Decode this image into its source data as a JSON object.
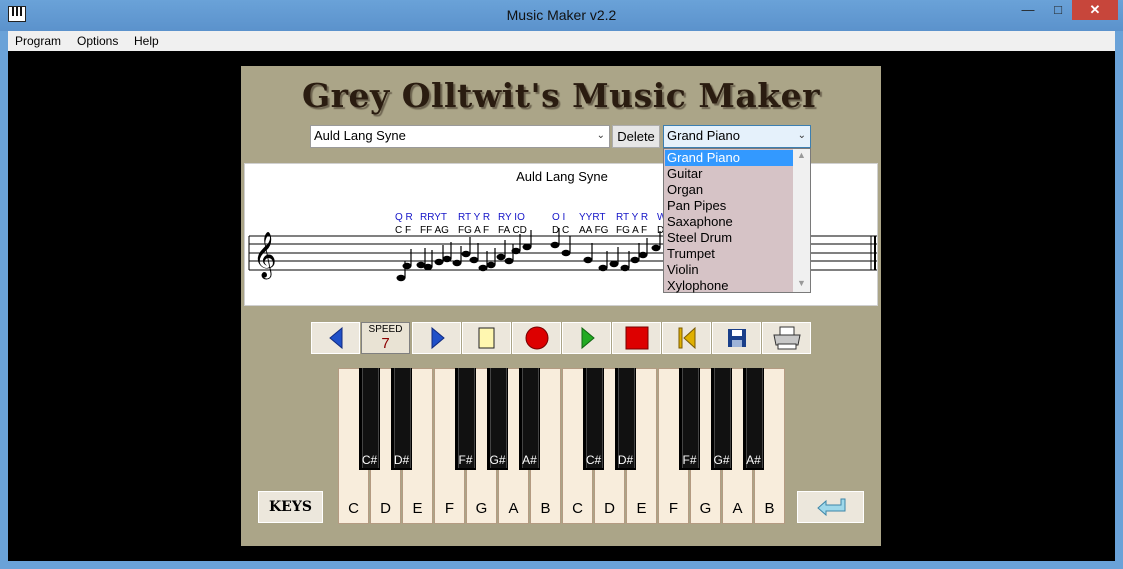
{
  "window": {
    "title": "Music Maker v2.2"
  },
  "menu": {
    "items": [
      "Program",
      "Options",
      "Help"
    ]
  },
  "app": {
    "heading": "Grey Olltwit's Music Maker"
  },
  "song_select": {
    "value": "Auld Lang Syne"
  },
  "delete_label": "Delete",
  "instrument_select": {
    "value": "Grand Piano",
    "options": [
      "Grand Piano",
      "Guitar",
      "Organ",
      "Pan Pipes",
      "Saxaphone",
      "Steel Drum",
      "Trumpet",
      "Violin",
      "Xylophone"
    ],
    "selected_index": 0
  },
  "score": {
    "title": "Auld Lang Syne",
    "key_letters": [
      "Q R",
      "RRYT",
      "RT Y R",
      "RY IO",
      "O I",
      "YYRT",
      "RT Y R",
      "W"
    ],
    "note_letters": [
      "C F",
      "FF AG",
      "FG A F",
      "FA CD",
      "D C",
      "AA FG",
      "FG A F",
      "D"
    ]
  },
  "speed": {
    "label": "SPEED",
    "value": "7"
  },
  "toolbar": {
    "icons": [
      "arrow-left-icon",
      "new-document-icon",
      "arrow-right-icon",
      "record-icon",
      "play-icon",
      "stop-icon",
      "rewind-to-start-icon",
      "save-icon",
      "print-icon"
    ]
  },
  "keyboard": {
    "white_keys": [
      "C",
      "D",
      "E",
      "F",
      "G",
      "A",
      "B",
      "C",
      "D",
      "E",
      "F",
      "G",
      "A",
      "B"
    ],
    "black_keys": [
      "C#",
      "D#",
      "F#",
      "G#",
      "A#",
      "C#",
      "D#",
      "F#",
      "G#",
      "A#"
    ]
  },
  "keys_button_label": "KEYS",
  "colors": {
    "panel": "#aba588",
    "key_ivory": "#f8eddc",
    "record_red": "#dd0000",
    "play_green": "#22aa22",
    "arrow_blue": "#2050c8",
    "list_bg": "#d6c3c6",
    "list_selected": "#3399ff"
  }
}
